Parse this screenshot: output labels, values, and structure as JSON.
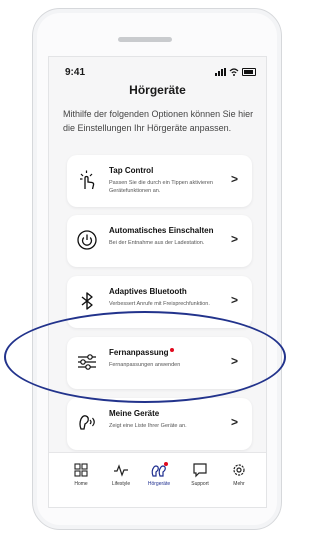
{
  "status": {
    "time": "9:41"
  },
  "header": {
    "title": "Hörgeräte"
  },
  "intro": "Mithilfe der folgenden Optionen können Sie hier die Einstellungen Ihr Hörgeräte anpassen.",
  "options": [
    {
      "title": "Tap Control",
      "subtitle": "Passen Sie die durch ein Tippen aktivieren Gerätefunktionen an.",
      "icon": "tap-icon"
    },
    {
      "title": "Automatisches Einschalten",
      "subtitle": "Bei der Entnahme aus der Ladestation.",
      "icon": "power-icon"
    },
    {
      "title": "Adaptives Bluetooth",
      "subtitle": "Verbessert Anrufe mit Freisprechfunktion.",
      "icon": "bluetooth-icon"
    },
    {
      "title": "Fernanpassung",
      "subtitle": "Fernanpassungen anwenden",
      "icon": "sliders-icon",
      "notification": true
    },
    {
      "title": "Meine Geräte",
      "subtitle": "Zeigt eine Liste Ihrer Geräte an.",
      "icon": "hearing-aid-icon"
    }
  ],
  "chevron": ">",
  "tabs": [
    {
      "label": "Home",
      "icon": "grid-icon"
    },
    {
      "label": "Lifestyle",
      "icon": "activity-icon"
    },
    {
      "label": "Hörgeräte",
      "icon": "hearing-aids-icon",
      "active": true,
      "notification": true
    },
    {
      "label": "Support",
      "icon": "chat-icon"
    },
    {
      "label": "Mehr",
      "icon": "gear-icon"
    }
  ],
  "colors": {
    "accent": "#1d2d8f",
    "notification": "#e10a1e",
    "highlight_oval": "#22338c"
  }
}
